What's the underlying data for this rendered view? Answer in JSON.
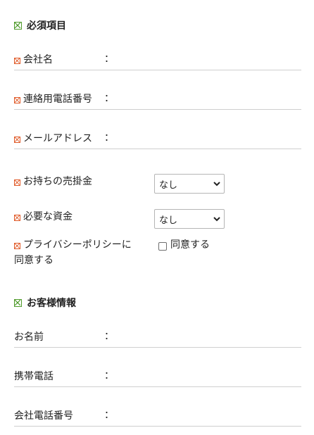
{
  "sections": {
    "required": {
      "title": "必須項目",
      "icon": "checkbox-cross-icon",
      "color": "#4e9a2a"
    },
    "customer": {
      "title": "お客様情報",
      "icon": "checkbox-cross-icon",
      "color": "#4e9a2a"
    }
  },
  "required_marker": {
    "icon": "required-mark-icon",
    "color": "#e05a28"
  },
  "colon": "：",
  "required_fields": {
    "company_name": {
      "label": "会社名",
      "value": ""
    },
    "contact_phone": {
      "label": "連絡用電話番号",
      "value": ""
    },
    "email": {
      "label": "メールアドレス",
      "value": ""
    },
    "receivables": {
      "label": "お持ちの売掛金",
      "selected": "なし"
    },
    "required_funds": {
      "label": "必要な資金",
      "selected": "なし"
    },
    "privacy": {
      "label_line1": "プライバシーポリシーに",
      "label_line2": "同意する",
      "checkbox_label": "同意する",
      "checked": false
    }
  },
  "customer_fields": {
    "name": {
      "label": "お名前",
      "value": ""
    },
    "mobile": {
      "label": "携帯電話",
      "value": ""
    },
    "company_phone": {
      "label": "会社電話番号",
      "value": ""
    }
  }
}
